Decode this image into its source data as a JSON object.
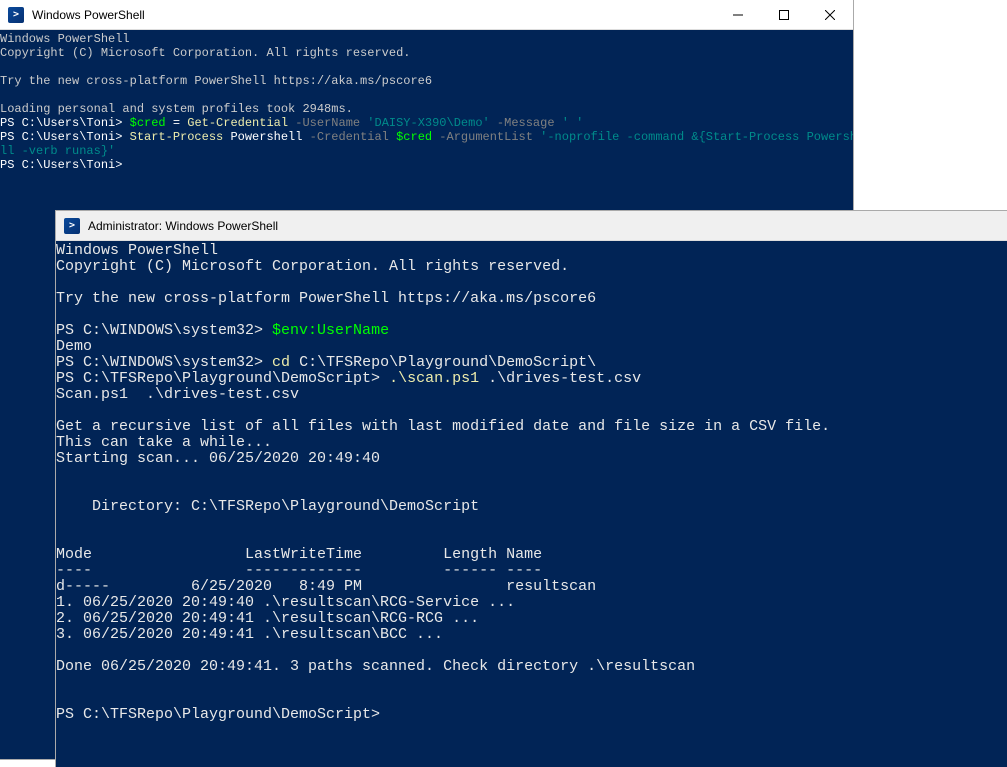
{
  "window1": {
    "title": "Windows PowerShell",
    "lines": {
      "l1": "Windows PowerShell",
      "l2": "Copyright (C) Microsoft Corporation. All rights reserved.",
      "l3": "Try the new cross-platform PowerShell https://aka.ms/pscore6",
      "l4": "Loading personal and system profiles took 2948ms.",
      "p1_prompt": "PS C:\\Users\\Toni> ",
      "p1_var": "$cred",
      "p1_eq": " = ",
      "p1_cmd": "Get-Credential",
      "p1_param1": " -UserName ",
      "p1_str1": "'DAISY-X390\\Demo'",
      "p1_param2": " -Message ",
      "p1_str2": "' '",
      "p2_prompt": "PS C:\\Users\\Toni> ",
      "p2_cmd": "Start-Process",
      "p2_arg1": " Powershell ",
      "p2_param1": "-Credential ",
      "p2_var": "$cred",
      "p2_param2": " -ArgumentList ",
      "p2_str": "'-noprofile -command &{Start-Process Powershe",
      "p2_str_cont": "ll -verb runas}'",
      "p3_prompt": "PS C:\\Users\\Toni>"
    }
  },
  "window2": {
    "title": "Administrator: Windows PowerShell",
    "lines": {
      "l1": "Windows PowerShell",
      "l2": "Copyright (C) Microsoft Corporation. All rights reserved.",
      "l3": "Try the new cross-platform PowerShell https://aka.ms/pscore6",
      "p1_prompt": "PS C:\\WINDOWS\\system32> ",
      "p1_cmd": "$env:UserName",
      "l4": "Demo",
      "p2_prompt": "PS C:\\WINDOWS\\system32> ",
      "p2_cmdlet": "cd",
      "p2_path": " C:\\TFSRepo\\Playground\\DemoScript\\",
      "p3_prompt": "PS C:\\TFSRepo\\Playground\\DemoScript> ",
      "p3_cmd": ".\\scan.ps1 ",
      "p3_arg": ".\\drives-test.csv",
      "l5": "Scan.ps1  .\\drives-test.csv",
      "l6": "Get a recursive list of all files with last modified date and file size in a CSV file.",
      "l7": "This can take a while...",
      "l8": "Starting scan... 06/25/2020 20:49:40",
      "l9": "    Directory: C:\\TFSRepo\\Playground\\DemoScript",
      "header": "Mode                 LastWriteTime         Length Name",
      "divider": "----                 -------------         ------ ----",
      "row1": "d-----         6/25/2020   8:49 PM                resultscan",
      "r1": "1. 06/25/2020 20:49:40 .\\resultscan\\RCG-Service ...",
      "r2": "2. 06/25/2020 20:49:41 .\\resultscan\\RCG-RCG ...",
      "r3": "3. 06/25/2020 20:49:41 .\\resultscan\\BCC ...",
      "done": "Done 06/25/2020 20:49:41. 3 paths scanned. Check directory .\\resultscan",
      "p4_prompt": "PS C:\\TFSRepo\\Playground\\DemoScript>"
    }
  }
}
